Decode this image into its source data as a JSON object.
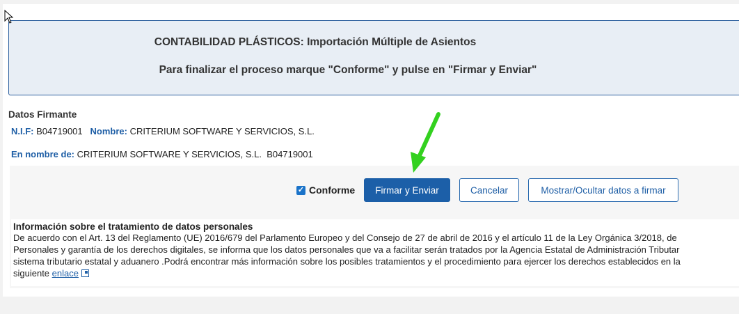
{
  "banner": {
    "title": "CONTABILIDAD PLÁSTICOS: Importación Múltiple de Asientos",
    "instruction": "Para finalizar el proceso marque \"Conforme\" y pulse en \"Firmar y Enviar\""
  },
  "firmante": {
    "section_title": "Datos Firmante",
    "nif_label": "N.I.F:",
    "nif_value": "B04719001",
    "nombre_label": "Nombre:",
    "nombre_value": "CRITERIUM SOFTWARE Y SERVICIOS, S.L.",
    "en_nombre_label": "En nombre de:",
    "en_nombre_value": "CRITERIUM SOFTWARE Y SERVICIOS, S.L.",
    "en_nombre_nif": "B04719001"
  },
  "actions": {
    "conforme_label": "Conforme",
    "conforme_checked": true,
    "firmar_label": "Firmar y Enviar",
    "cancelar_label": "Cancelar",
    "toggle_label": "Mostrar/Ocultar datos a firmar"
  },
  "info": {
    "title": "Información sobre el tratamiento de datos personales",
    "line1": "De acuerdo con el Art. 13 del Reglamento (UE) 2016/679 del Parlamento Europeo y del Consejo de 27 de abril de 2016 y el artículo 11 de la Ley Orgánica 3/2018, de",
    "line2": "Personales y garantía de los derechos digitales, se informa que los datos personales que va a facilitar serán tratados por la Agencia Estatal de Administración Tributar",
    "line3": "sistema tributario estatal y aduanero .Podrá encontrar más información sobre los posibles tratamientos y el procedimiento para ejercer los derechos establecidos en la",
    "line4_prefix": "siguiente",
    "link_label": "enlace"
  },
  "colors": {
    "accent": "#1c5fa8",
    "banner_bg": "#e8eef5",
    "arrow": "#33d11f"
  }
}
